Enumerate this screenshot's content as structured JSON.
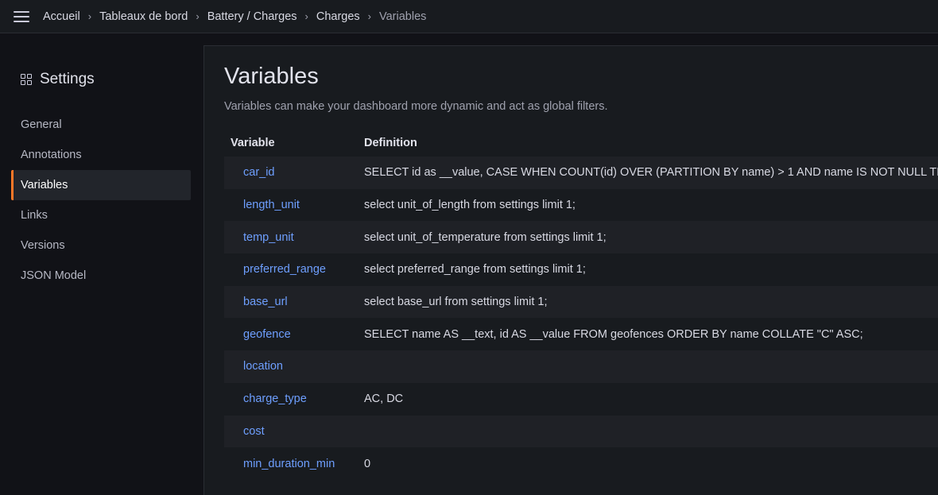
{
  "breadcrumb": [
    {
      "label": "Accueil"
    },
    {
      "label": "Tableaux de bord"
    },
    {
      "label": "Battery / Charges"
    },
    {
      "label": "Charges"
    },
    {
      "label": "Variables"
    }
  ],
  "sidebar": {
    "title": "Settings",
    "items": [
      {
        "label": "General",
        "active": false
      },
      {
        "label": "Annotations",
        "active": false
      },
      {
        "label": "Variables",
        "active": true
      },
      {
        "label": "Links",
        "active": false
      },
      {
        "label": "Versions",
        "active": false
      },
      {
        "label": "JSON Model",
        "active": false
      }
    ]
  },
  "main": {
    "title": "Variables",
    "subtitle": "Variables can make your dashboard more dynamic and act as global filters.",
    "columns": {
      "variable": "Variable",
      "definition": "Definition"
    },
    "rows": [
      {
        "name": "car_id",
        "definition": "SELECT id as __value, CASE WHEN COUNT(id) OVER (PARTITION BY name) > 1 AND name IS NOT NULL THEN CONCAT(name, ' - ', RIGHT(vin, 6)) ELSE COALESCE(name, CONCAT('VIN ', vin)) end as __text FROM cars ORDER BY display_priority ASC, name ASC, vin ASC;"
      },
      {
        "name": "length_unit",
        "definition": "select unit_of_length from settings limit 1;"
      },
      {
        "name": "temp_unit",
        "definition": "select unit_of_temperature from settings limit 1;"
      },
      {
        "name": "preferred_range",
        "definition": "select preferred_range from settings limit 1;"
      },
      {
        "name": "base_url",
        "definition": "select base_url from settings limit 1;"
      },
      {
        "name": "geofence",
        "definition": "SELECT name AS __text, id AS __value FROM geofences ORDER BY name COLLATE \"C\" ASC;"
      },
      {
        "name": "location",
        "definition": ""
      },
      {
        "name": "charge_type",
        "definition": "AC, DC"
      },
      {
        "name": "cost",
        "definition": ""
      },
      {
        "name": "min_duration_min",
        "definition": "0"
      }
    ]
  }
}
